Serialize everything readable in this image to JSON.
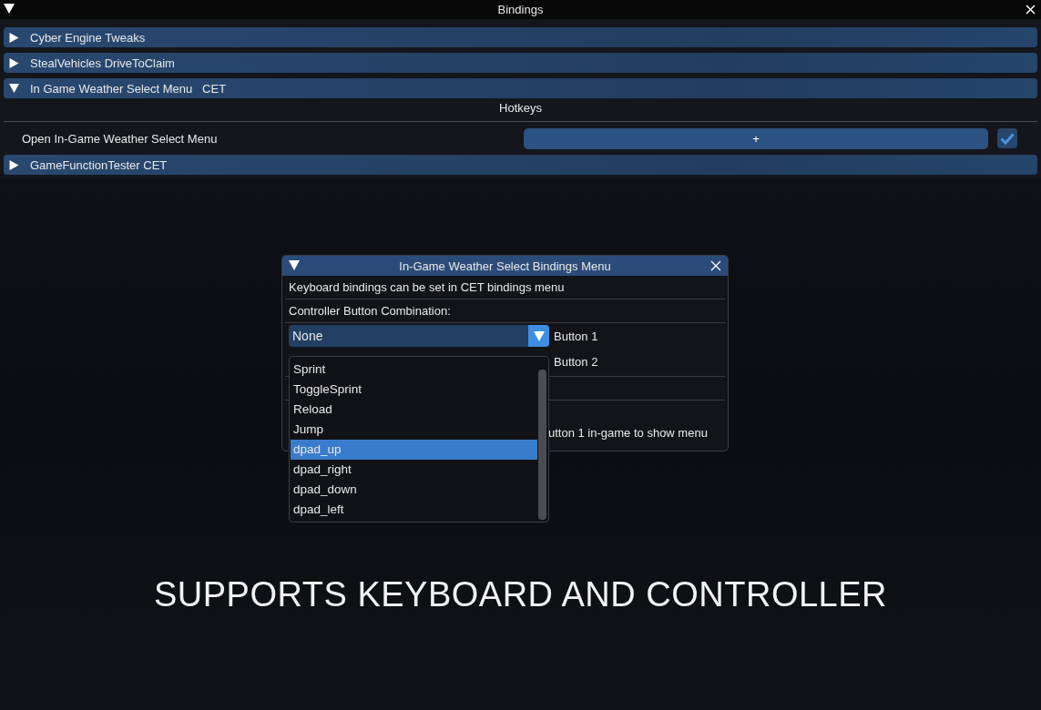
{
  "window": {
    "title": "Bindings"
  },
  "sections": [
    {
      "label": "Cyber Engine Tweaks",
      "expanded": false
    },
    {
      "label": "StealVehicles DriveToClaim",
      "expanded": false
    },
    {
      "label": "In Game Weather Select Menu   CET",
      "expanded": true,
      "heading": "Hotkeys",
      "hotkeys": [
        {
          "label": "Open In-Game Weather Select Menu",
          "button": "+",
          "checked": true
        }
      ]
    },
    {
      "label": "GameFunctionTester CET",
      "expanded": false
    }
  ],
  "dialog": {
    "title": "In-Game Weather Select Bindings Menu",
    "note": "Keyboard bindings can be set in CET bindings menu",
    "combination_label": "Controller Button Combination:",
    "combos": [
      {
        "value": "None",
        "label": "Button 1",
        "open": true
      },
      {
        "label": "Button 2"
      }
    ],
    "footer": "utton 1 in-game to show menu"
  },
  "dropdown": {
    "options": [
      {
        "label": "Sprint",
        "selected": false
      },
      {
        "label": "ToggleSprint",
        "selected": false
      },
      {
        "label": "Reload",
        "selected": false
      },
      {
        "label": "Jump",
        "selected": false
      },
      {
        "label": "dpad_up",
        "selected": true
      },
      {
        "label": "dpad_right",
        "selected": false
      },
      {
        "label": "dpad_down",
        "selected": false
      },
      {
        "label": "dpad_left",
        "selected": false
      }
    ]
  },
  "caption": "SUPPORTS KEYBOARD AND CONTROLLER"
}
